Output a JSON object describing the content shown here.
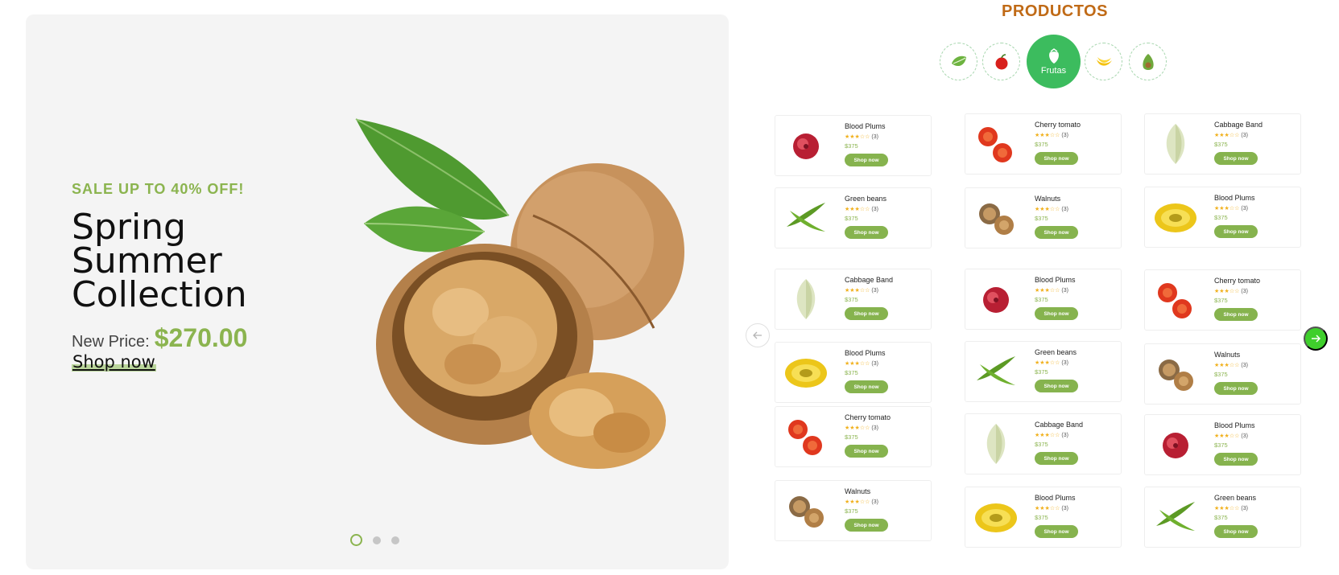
{
  "hero": {
    "sale_text": "SALE UP TO 40% OFF!",
    "title": "Spring Summer Collection",
    "price_label": "New Price:",
    "price_value": "$270.00",
    "shop_link": "Shop now",
    "image": "walnut-image",
    "slide_count": 3,
    "active_slide": 1
  },
  "products": {
    "section_title": "PRODUCTOS",
    "categories": [
      {
        "icon": "leafy-vegetable-icon",
        "label": ""
      },
      {
        "icon": "apple-icon",
        "label": ""
      },
      {
        "icon": "strawberry-icon",
        "label": "Frutas",
        "active": true
      },
      {
        "icon": "banana-icon",
        "label": ""
      },
      {
        "icon": "avocado-icon",
        "label": ""
      }
    ],
    "button_label": "Shop now",
    "price": "$375",
    "rating_count": "(3)",
    "stars": "★★★☆☆",
    "columns": [
      [
        {
          "name": "Blood Plums",
          "image": "plum"
        },
        {
          "name": "Green beans",
          "image": "beans"
        },
        {
          "name": "Cabbage Band",
          "image": "cabbage"
        },
        {
          "name": "Blood Plums",
          "image": "kiwano"
        },
        {
          "name": "Cherry tomato",
          "image": "tomato"
        },
        {
          "name": "Walnuts",
          "image": "walnut"
        }
      ],
      [
        {
          "name": "Cherry tomato",
          "image": "tomato"
        },
        {
          "name": "Walnuts",
          "image": "walnut"
        },
        {
          "name": "Blood Plums",
          "image": "plum"
        },
        {
          "name": "Green beans",
          "image": "beans"
        },
        {
          "name": "Cabbage Band",
          "image": "cabbage"
        },
        {
          "name": "Blood Plums",
          "image": "kiwano"
        }
      ],
      [
        {
          "name": "Cabbage Band",
          "image": "cabbage"
        },
        {
          "name": "Blood Plums",
          "image": "kiwano"
        },
        {
          "name": "Cherry tomato",
          "image": "tomato"
        },
        {
          "name": "Walnuts",
          "image": "walnut"
        },
        {
          "name": "Blood Plums",
          "image": "plum"
        },
        {
          "name": "Green beans",
          "image": "beans"
        }
      ]
    ]
  },
  "nav": {
    "prev_icon": "arrow-left-icon",
    "next_icon": "arrow-right-icon"
  },
  "colors": {
    "accent_green": "#8bb44f",
    "active_category": "#3cbc5e",
    "next_arrow": "#3fcf2c",
    "title_orange": "#c06a16",
    "star": "#f1b11e"
  }
}
